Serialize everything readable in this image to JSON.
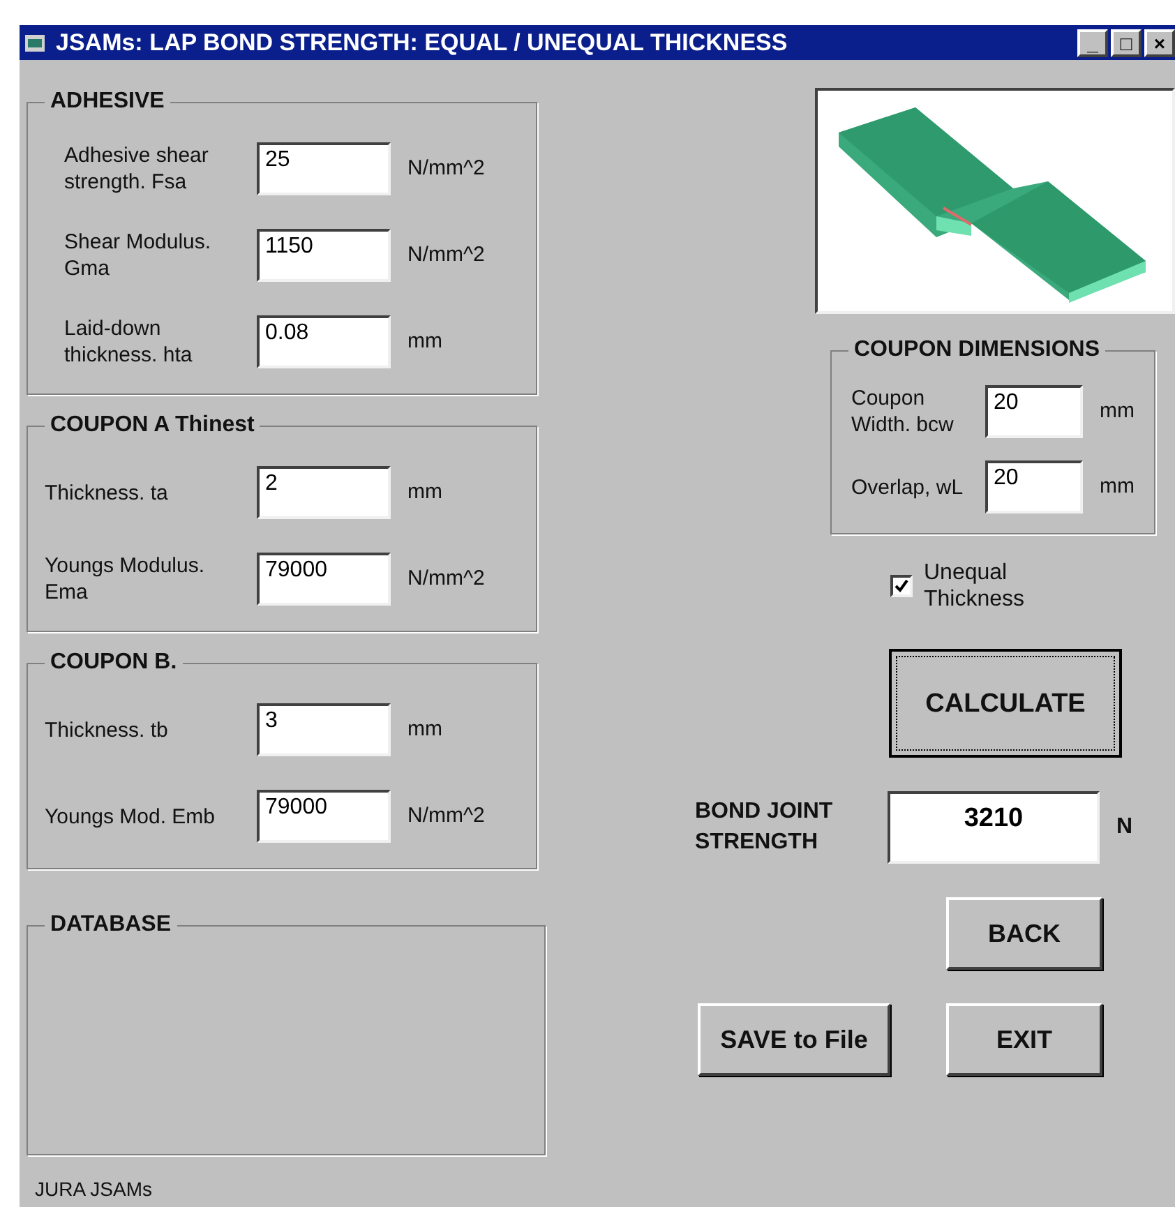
{
  "window": {
    "title": "JSAMs: LAP BOND STRENGTH: EQUAL /  UNEQUAL THICKNESS",
    "controls": [
      "_",
      "□",
      "×"
    ]
  },
  "groups": [
    {
      "title": "ADHESIVE",
      "fields": [
        {
          "label": "Adhesive shear strength.   Fsa",
          "value": "25",
          "unit": "N/mm^2"
        },
        {
          "label": "Shear Modulus. Gma",
          "value": "1150",
          "unit": "N/mm^2"
        },
        {
          "label": "Laid-down thickness.  hta",
          "value": "0.08",
          "unit": "mm"
        }
      ]
    },
    {
      "title": "COUPON A Thinest",
      "fields": [
        {
          "label": "Thickness.   ta",
          "value": "2",
          "unit": "mm"
        },
        {
          "label": "Youngs Modulus. Ema",
          "value": "79000",
          "unit": "N/mm^2"
        }
      ]
    },
    {
      "title": "COUPON B.",
      "fields": [
        {
          "label": "Thickness.   tb",
          "value": "3",
          "unit": "mm"
        },
        {
          "label": "Youngs Mod. Emb",
          "value": "79000",
          "unit": "N/mm^2"
        }
      ]
    }
  ],
  "database": {
    "title": "DATABASE"
  },
  "coupon_dimensions": {
    "title": "COUPON DIMENSIONS",
    "fields": [
      {
        "label": "Coupon Width.  bcw",
        "value": "20",
        "unit": "mm"
      },
      {
        "label": "Overlap, wL",
        "value": "20",
        "unit": "mm"
      }
    ]
  },
  "unequal_thickness": {
    "label": "Unequal Thickness",
    "checked": true
  },
  "calculate_button": "CALCULATE",
  "result": {
    "label": "BOND JOINT STRENGTH",
    "value": "3210",
    "unit": "N"
  },
  "buttons": {
    "back": "BACK",
    "save": "SAVE to File",
    "exit": "EXIT"
  },
  "status": "JURA JSAMs"
}
